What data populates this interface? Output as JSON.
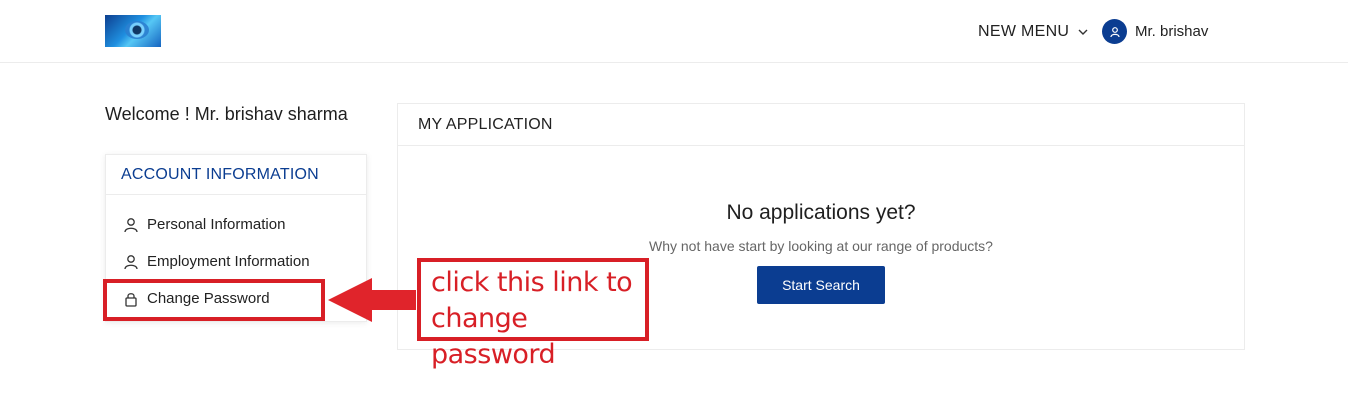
{
  "header": {
    "logo_icon": "eye-logo-icon",
    "menu_label": "NEW MENU",
    "user_name": "Mr. brishav"
  },
  "sidebar": {
    "welcome": "Welcome ! Mr. brishav sharma",
    "section_title": "ACCOUNT INFORMATION",
    "items": [
      {
        "label": "Personal Information",
        "icon": "user-icon"
      },
      {
        "label": "Employment Information",
        "icon": "user-icon"
      },
      {
        "label": "Change Password",
        "icon": "lock-icon"
      }
    ]
  },
  "main": {
    "title": "MY APPLICATION",
    "empty_title": "No applications yet?",
    "empty_subtitle": "Why not have start by looking at our range of products?",
    "button_label": "Start Search"
  },
  "annotation": {
    "lines": [
      "click this link to",
      "change password"
    ],
    "color": "#d81f26"
  },
  "colors": {
    "brand": "#0b3d91",
    "accent_red": "#d81f26"
  }
}
